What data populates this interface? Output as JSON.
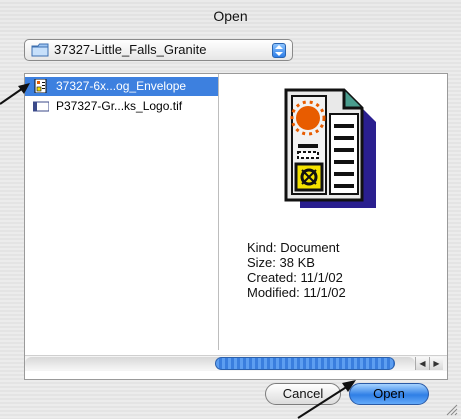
{
  "window": {
    "title": "Open"
  },
  "location": {
    "folder_name": "37327-Little_Falls_Granite"
  },
  "files": [
    {
      "name": "37327-6x...og_Envelope",
      "selected": true,
      "icon": "document-icon"
    },
    {
      "name": "P37327-Gr...ks_Logo.tif",
      "selected": false,
      "icon": "tif-file-icon"
    }
  ],
  "preview": {
    "kind": "Kind: Document",
    "size": "Size: 38 KB",
    "created": "Created: 11/1/02",
    "modified": "Modified: 11/1/02"
  },
  "buttons": {
    "cancel": "Cancel",
    "open": "Open"
  },
  "colors": {
    "selection": "#3d80df",
    "primary_button": "#2f7fe6"
  }
}
